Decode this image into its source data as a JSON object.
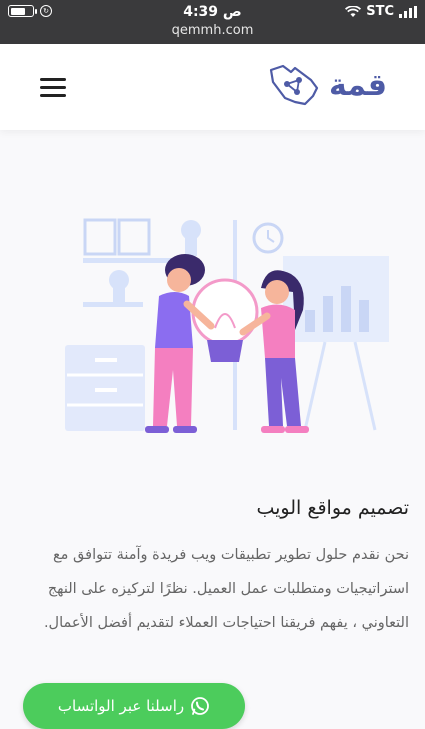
{
  "status_bar": {
    "time": "4:39 ص",
    "url": "qemmh.com",
    "carrier": "STC",
    "battery_level": 0.7
  },
  "header": {
    "logo_text": "قمة",
    "menu_icon": "hamburger-icon"
  },
  "section": {
    "title": "تصميم مواقع الويب",
    "description": "نحن نقدم حلول تطوير تطبيقات ويب فريدة وآمنة تتوافق مع استراتيجيات ومتطلبات عمل العميل. نظرًا لتركيزه على النهج التعاوني ، يفهم فريقنا احتياجات العملاء لتقديم أفضل الأعمال."
  },
  "whatsapp_button": {
    "label": "راسلنا عبر الواتساب",
    "icon": "whatsapp-icon"
  },
  "colors": {
    "brand": "#4e5ba6",
    "whatsapp": "#4ccc5c",
    "status_bar": "#3a3a3c"
  }
}
